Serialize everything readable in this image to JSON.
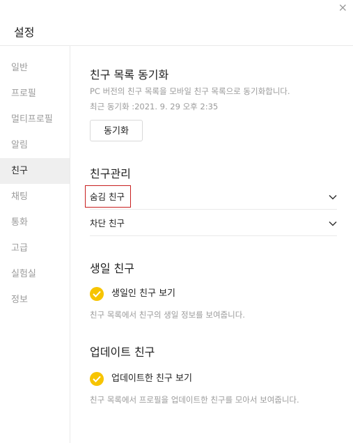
{
  "window": {
    "title": "설정",
    "close_symbol": "×"
  },
  "sidebar": {
    "items": [
      {
        "label": "일반"
      },
      {
        "label": "프로필"
      },
      {
        "label": "멀티프로필"
      },
      {
        "label": "알림"
      },
      {
        "label": "친구",
        "active": true
      },
      {
        "label": "채팅"
      },
      {
        "label": "통화"
      },
      {
        "label": "고급"
      },
      {
        "label": "실험실"
      },
      {
        "label": "정보"
      }
    ]
  },
  "sync": {
    "heading": "친구 목록 동기화",
    "description": "PC 버전의 친구 목록을 모바일 친구 목록으로 동기화합니다.",
    "last_sync": "최근 동기화 :2021. 9. 29 오후 2:35",
    "button_label": "동기화"
  },
  "manage": {
    "heading": "친구관리",
    "hidden_friends": "숨김 친구",
    "blocked_friends": "차단 친구"
  },
  "birthday": {
    "heading": "생일 친구",
    "option_label": "생일인 친구 보기",
    "checked": true,
    "description": "친구 목록에서 친구의 생일 정보를 보여줍니다."
  },
  "updated": {
    "heading": "업데이트 친구",
    "option_label": "업데이트한 친구 보기",
    "checked": true,
    "description": "친구 목록에서 프로필을 업데이트한 친구를 모아서 보여줍니다."
  },
  "colors": {
    "accent": "#f7c400",
    "highlight_border": "#c81e1e",
    "active_bg": "#efefef"
  }
}
